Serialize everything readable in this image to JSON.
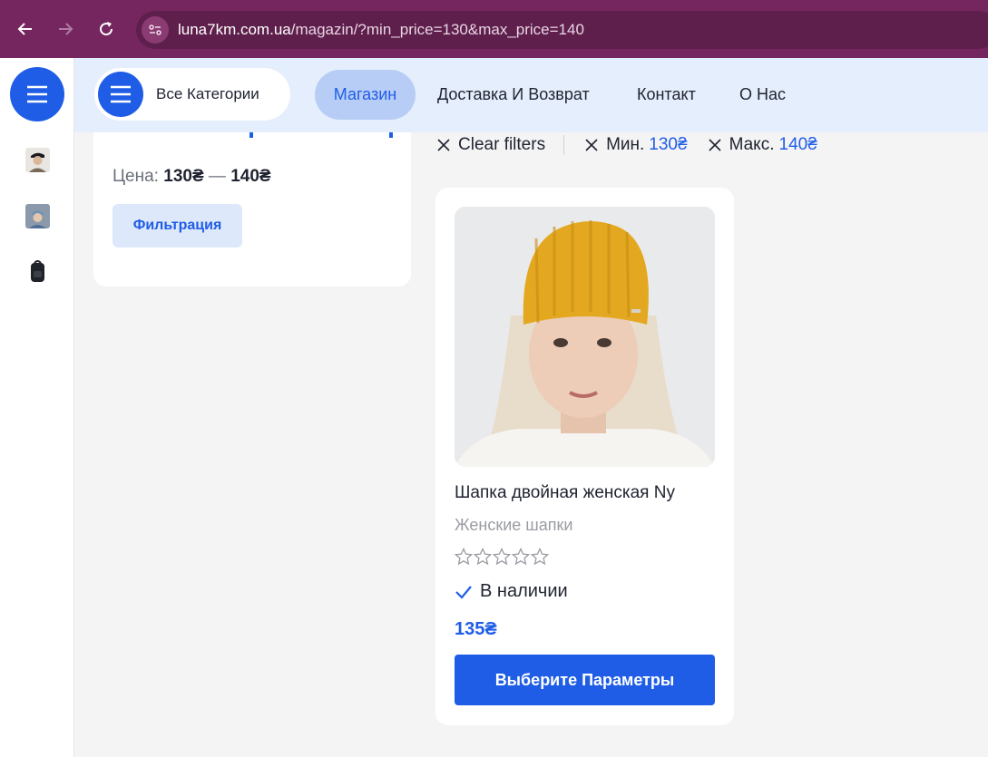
{
  "browser": {
    "url_host": "luna7km.com.ua",
    "url_path": "/magazin/?min_price=130&max_price=140"
  },
  "header": {
    "categories_label": "Все Категории",
    "nav": [
      {
        "label": "Магазин",
        "active": true
      },
      {
        "label": "Доставка И Возврат",
        "active": false
      },
      {
        "label": "Контакт",
        "active": false
      },
      {
        "label": "О Нас",
        "active": false
      }
    ]
  },
  "filter": {
    "price_label": "Цена:",
    "price_min": "130₴",
    "price_dash": "—",
    "price_max": "140₴",
    "button_label": "Фильтрация"
  },
  "active_filters": {
    "clear_label": "Clear filters",
    "min_label": "Мин.",
    "min_value": "130₴",
    "max_label": "Макс.",
    "max_value": "140₴"
  },
  "product": {
    "title": "Шапка двойная женская Ny",
    "category": "Женские шапки",
    "rating": 0,
    "rating_max": 5,
    "stock_label": "В наличии",
    "price": "135₴",
    "button_label": "Выберите Параметры"
  },
  "colors": {
    "accent": "#1f5de6",
    "browser_frame": "#76265f",
    "header_bg": "#e5eefc"
  }
}
